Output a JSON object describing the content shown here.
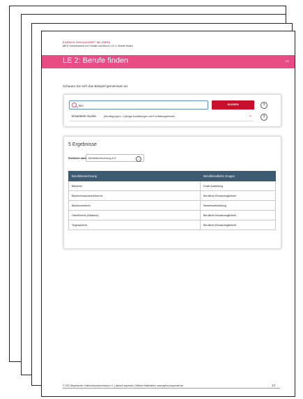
{
  "header": {
    "kicker": "EINFACH ORGANISIERT IM LEBEN",
    "sub_bold": "LE 2:",
    "sub_text": "Vereinbarkeit von Familie und Beruf • LE 2: Berufe finden"
  },
  "banner": {
    "title": "LE 2: Berufe finden",
    "page_indicator": "2/4"
  },
  "intro": "Schauen Sie sich das Beispiel gemeinsam an:",
  "search": {
    "value": "Bro",
    "button_label": "SUCHEN",
    "help_label": "?",
    "advanced_label": "Erweiterte Suche",
    "advanced_hint": "(Berufsgruppen, 2-jährige Ausbildungen und Fortbildungsberufe)",
    "chevron": "⌄"
  },
  "results": {
    "heading": "5 Ergebnisse",
    "sort_label": "Sortieren nach",
    "sort_value": "Berufsbezeichnung A-Z",
    "columns": [
      "Berufsbezeichnung",
      "Berufskundliche Gruppe"
    ],
    "rows": [
      [
        "Bäcker/in",
        "Duale Ausbildung"
      ],
      [
        "Bäckereimaschinenführer/in",
        "Berufliche Einsatzmöglichkeit"
      ],
      [
        "Bäckermeister/in",
        "Meisterweiterbildung"
      ],
      [
        "Oberführer/in (Bäckerei)",
        "Berufliche Einsatzmöglichkeit"
      ],
      [
        "Teigmacher/in",
        "Berufliche Einsatzmöglichkeit"
      ]
    ]
  },
  "footer": {
    "text": "© 2021 Bayerischer Volkshochschulverband e.V. | Alpha-Kooperativ | Weitere Materialien: www.alpha-kooperativ.de",
    "page_number": "13"
  },
  "colors": {
    "accent": "#e94b84",
    "button": "#c8102e",
    "table_header": "#3d5a73"
  }
}
